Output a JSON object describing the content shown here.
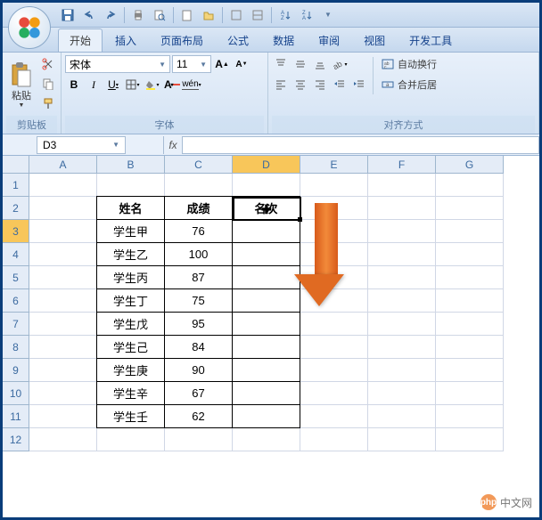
{
  "qat": {
    "buttons": [
      "save",
      "undo",
      "redo",
      "print",
      "preview",
      "new",
      "open",
      "quick-print",
      "spelling",
      "sort-asc",
      "sort-desc"
    ]
  },
  "tabs": {
    "items": [
      "开始",
      "插入",
      "页面布局",
      "公式",
      "数据",
      "审阅",
      "视图",
      "开发工具"
    ],
    "active_index": 0
  },
  "ribbon": {
    "clipboard": {
      "paste": "粘贴",
      "title": "剪贴板"
    },
    "font": {
      "name": "宋体",
      "size": "11",
      "title": "字体"
    },
    "alignment": {
      "wrap": "自动换行",
      "merge": "合并后居",
      "title": "对齐方式"
    }
  },
  "namebox": "D3",
  "formula": "",
  "columns": [
    "A",
    "B",
    "C",
    "D",
    "E",
    "F",
    "G"
  ],
  "rows": [
    "1",
    "2",
    "3",
    "4",
    "5",
    "6",
    "7",
    "8",
    "9",
    "10",
    "11",
    "12"
  ],
  "selected_col": 3,
  "selected_row": 2,
  "table": {
    "headers": [
      "姓名",
      "成绩",
      "名次"
    ],
    "data": [
      [
        "学生甲",
        "76",
        ""
      ],
      [
        "学生乙",
        "100",
        ""
      ],
      [
        "学生丙",
        "87",
        ""
      ],
      [
        "学生丁",
        "75",
        ""
      ],
      [
        "学生戊",
        "95",
        ""
      ],
      [
        "学生己",
        "84",
        ""
      ],
      [
        "学生庚",
        "90",
        ""
      ],
      [
        "学生辛",
        "67",
        ""
      ],
      [
        "学生壬",
        "62",
        ""
      ]
    ]
  },
  "watermark": "中文网"
}
